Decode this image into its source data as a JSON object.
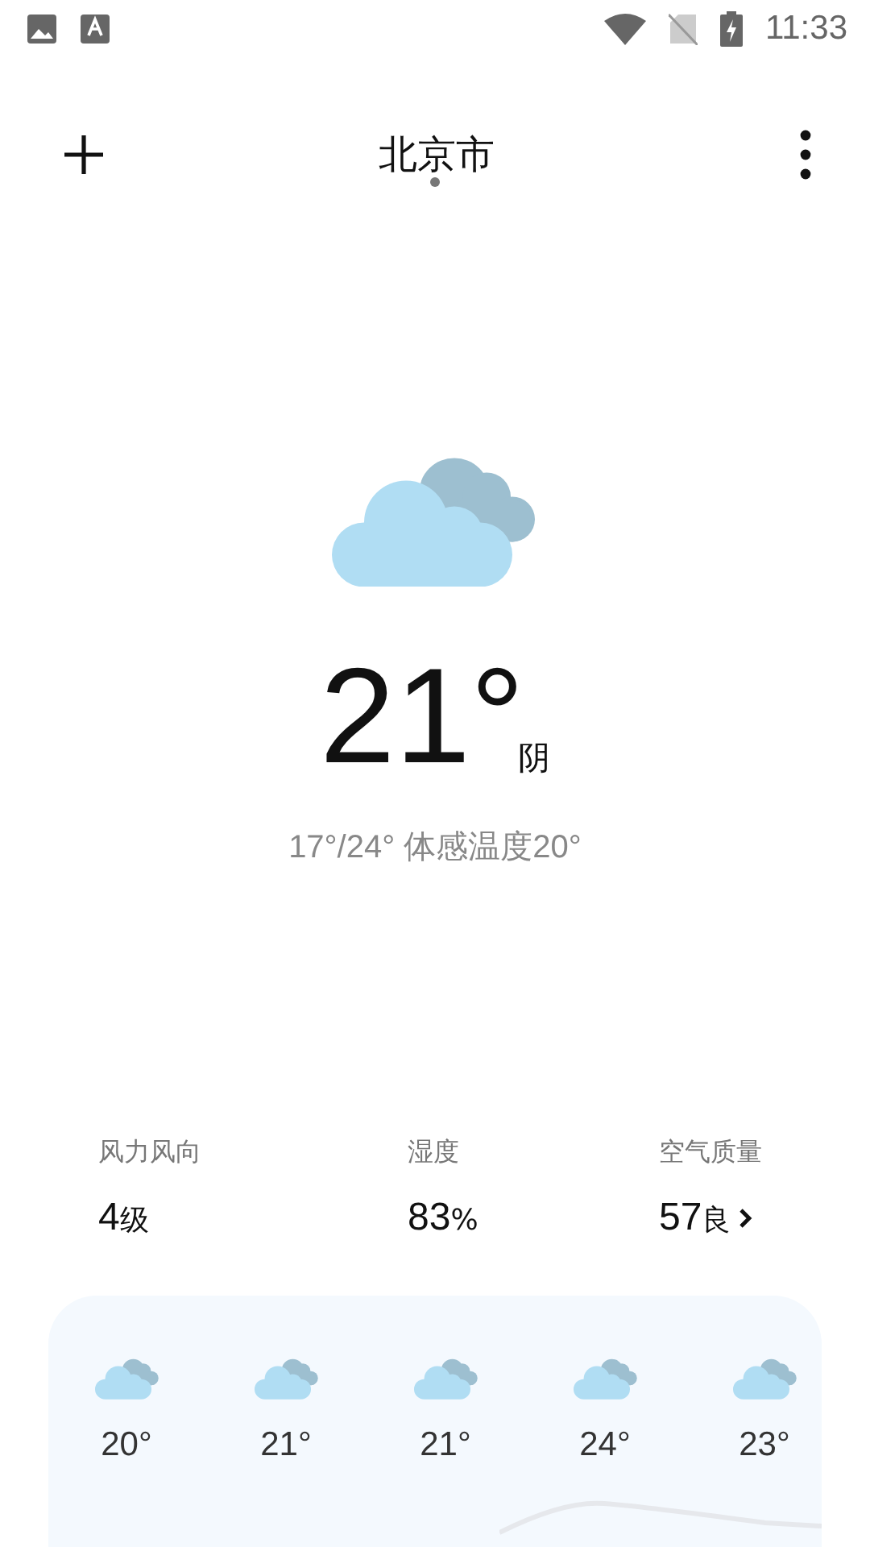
{
  "status_bar": {
    "time": "11:33"
  },
  "header": {
    "city": "北京市",
    "page_dots": [
      {
        "selected": true
      }
    ]
  },
  "current": {
    "temperature": "21°",
    "condition": "阴",
    "range": "17°/24° 体感温度20°"
  },
  "stats": [
    {
      "label": "风力风向",
      "value": "4",
      "unit": "级",
      "link": false
    },
    {
      "label": "湿度",
      "value": "83",
      "unit": "%",
      "link": false
    },
    {
      "label": "空气质量",
      "value": "57",
      "unit": "良",
      "link": true
    }
  ],
  "hourly": [
    {
      "temp": "20°"
    },
    {
      "temp": "21°"
    },
    {
      "temp": "21°"
    },
    {
      "temp": "24°"
    },
    {
      "temp": "23°"
    }
  ]
}
